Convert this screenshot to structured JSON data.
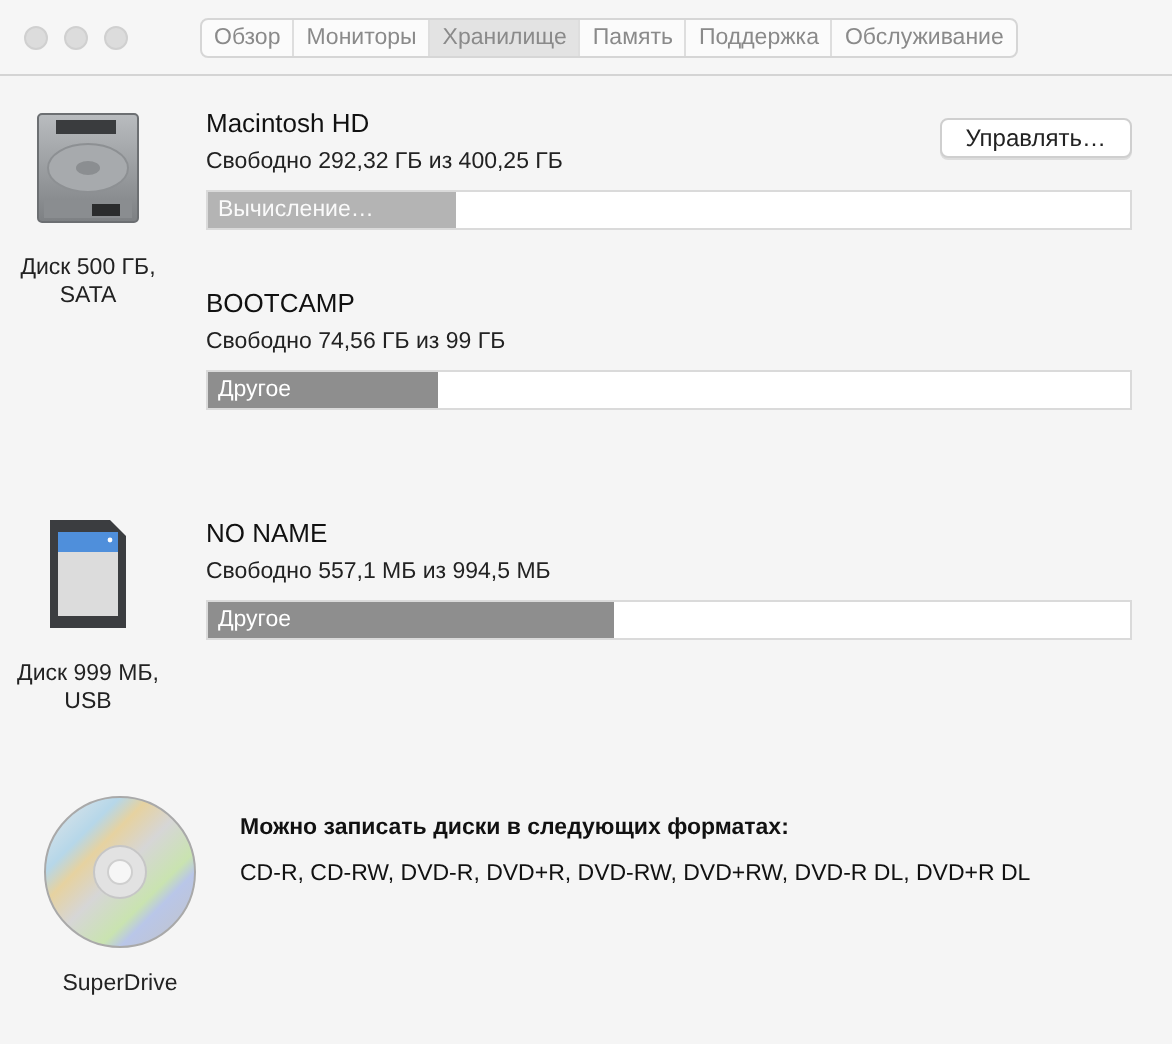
{
  "tabs": [
    {
      "label": "Обзор",
      "selected": false
    },
    {
      "label": "Мониторы",
      "selected": false
    },
    {
      "label": "Хранилище",
      "selected": true
    },
    {
      "label": "Память",
      "selected": false
    },
    {
      "label": "Поддержка",
      "selected": false
    },
    {
      "label": "Обслуживание",
      "selected": false
    }
  ],
  "devices": [
    {
      "kind": "hdd",
      "label": "Диск 500 ГБ, SATA",
      "volumes": [
        {
          "name": "Macintosh HD",
          "free": "Свободно 292,32 ГБ из 400,25 ГБ",
          "button": "Управлять…",
          "bar": {
            "kind": "calculating",
            "label": "Вычисление…",
            "level": 0.27
          }
        },
        {
          "name": "BOOTCAMP",
          "free": "Свободно 74,56 ГБ из 99 ГБ",
          "bar": {
            "kind": "category",
            "label": "Другое",
            "level": 0.25
          }
        }
      ]
    },
    {
      "kind": "sd",
      "label": "Диск 999 МБ, USB",
      "volumes": [
        {
          "name": "NO NAME",
          "free": "Свободно 557,1 МБ из 994,5 МБ",
          "bar": {
            "kind": "category",
            "label": "Другое",
            "level": 0.44
          }
        }
      ]
    },
    {
      "kind": "optical",
      "label": "SuperDrive",
      "formats_title": "Можно записать диски в следующих форматах:",
      "formats": "CD-R, CD-RW, DVD-R, DVD+R, DVD-RW, DVD+RW, DVD-R DL, DVD+R DL"
    }
  ]
}
